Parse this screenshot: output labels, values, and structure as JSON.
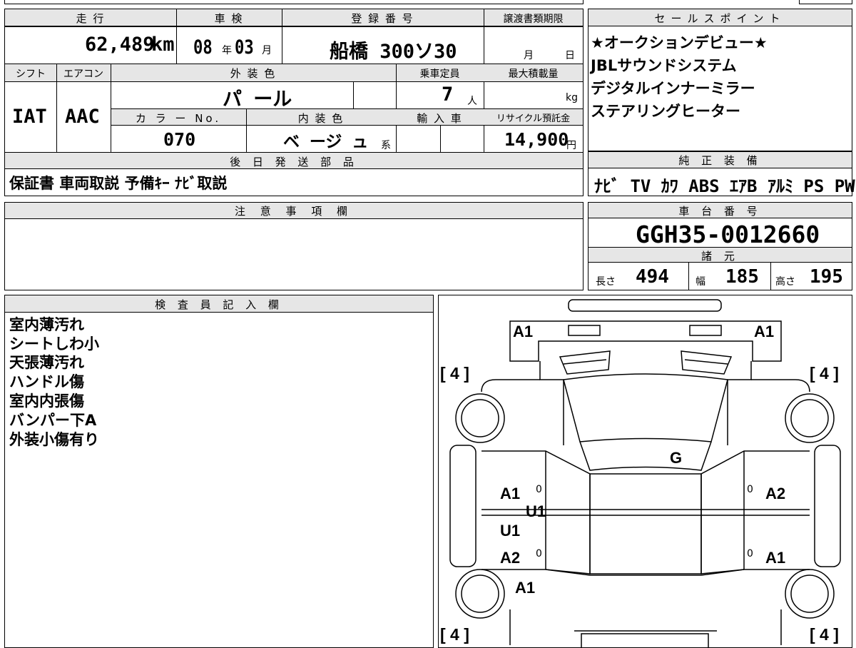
{
  "header": {
    "mileage_label": "走 行",
    "inspection_label": "車 検",
    "registration_label": "登 録 番 号",
    "transfer_deadline_label": "譲渡書類期限"
  },
  "vehicle": {
    "mileage": "62,489",
    "mileage_unit": "km",
    "inspection_year": "08",
    "inspection_year_unit": "年",
    "inspection_month": "03",
    "inspection_month_unit": "月",
    "registration_number": "船橋 300ソ30",
    "transfer_month_unit": "月",
    "transfer_day_unit": "日",
    "shift_label": "シフト",
    "shift": "IAT",
    "aircon_label": "エアコン",
    "aircon": "AAC",
    "exterior_color_label": "外 装 色",
    "exterior_color": "パ ール",
    "capacity_label": "乗車定員",
    "capacity": "7",
    "capacity_unit": "人",
    "max_load_label": "最大積載量",
    "max_load_unit": "kg",
    "color_no_label": "カ ラ ー No.",
    "color_no": "070",
    "interior_color_label": "内 装 色",
    "interior_color": "ベ ージ ュ",
    "interior_color_suffix": "系",
    "import_label": "輸 入 車",
    "recycle_label": "リサイクル預託金",
    "recycle_fee": "14,900",
    "recycle_unit": "円"
  },
  "later_parts": {
    "label": "後 日 発 送 部 品",
    "items": "保証書 車両取説 予備ｷｰ ﾅﾋﾞ取説"
  },
  "sales_points": {
    "label": "セールスポイント",
    "items": [
      "★オークションデビュー★",
      "JBLサウンドシステム",
      "デジタルインナーミラー",
      "ステアリングヒーター"
    ]
  },
  "equipment": {
    "label": "純 正 装 備",
    "items": "ﾅﾋﾞ  TV  ｶﾜ  ABS  ｴｱB  ｱﾙﾐ  PS  PW"
  },
  "notes": {
    "label": "注 意 事 項 欄"
  },
  "chassis": {
    "label": "車 台 番 号",
    "number": "GGH35-0012660"
  },
  "specs": {
    "label": "諸 元",
    "length_label": "長さ",
    "length": "494",
    "width_label": "幅",
    "width": "185",
    "height_label": "高さ",
    "height": "195"
  },
  "inspector": {
    "label": "検 査 員 記 入 欄",
    "comments": [
      "室内薄汚れ",
      "シートしわ小",
      "天張薄汚れ",
      "ハンドル傷",
      "室内内張傷",
      "バンパー下A",
      "外装小傷有り"
    ]
  },
  "diagram": {
    "marks": {
      "front_left": "A1",
      "front_right": "A1",
      "roof": "G",
      "left_front_door": "A1",
      "left_center": "U1",
      "left_rear_door_u": "U1",
      "left_rear_door": "A2",
      "left_rear": "A1",
      "right_front_door": "A2",
      "right_rear_door": "A1",
      "zero1": "0",
      "zero2": "0",
      "zero3": "0",
      "zero4": "0"
    },
    "tires": [
      "[ 4 ]",
      "[ 4 ]",
      "[ 4 ]",
      "[ 4 ]"
    ]
  }
}
